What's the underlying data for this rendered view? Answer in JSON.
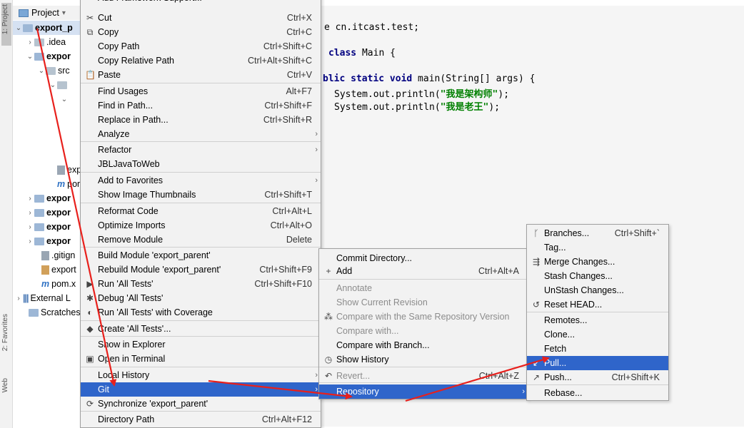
{
  "left_strip": {
    "project_tab": "1: Project",
    "favorites_tab": "2: Favorites",
    "web_tab": "Web"
  },
  "project_panel": {
    "header_label": "Project",
    "header_chevron": "▾",
    "tree": [
      {
        "arrow": "⌄",
        "icon": "folder",
        "label": "export_p",
        "bold": true
      },
      {
        "arrow": "›",
        "icon": "folder-gray",
        "label": ".idea",
        "bold": false
      },
      {
        "arrow": "⌄",
        "icon": "folder",
        "label": "expor",
        "bold": true
      },
      {
        "arrow": "⌄",
        "icon": "folder-gray",
        "label": "src",
        "bold": false
      },
      {
        "arrow": "⌄",
        "icon": "folder-gray",
        "label": "",
        "bold": false
      },
      {
        "arrow": "⌄",
        "icon": "",
        "label": "",
        "bold": false
      },
      {
        "arrow": "",
        "icon": "file-gen",
        "label": "exp",
        "bold": false
      },
      {
        "arrow": "",
        "icon": "file-m",
        "label": "pom",
        "bold": false
      },
      {
        "arrow": "›",
        "icon": "folder",
        "label": "expor",
        "bold": true
      },
      {
        "arrow": "›",
        "icon": "folder",
        "label": "expor",
        "bold": true
      },
      {
        "arrow": "›",
        "icon": "folder",
        "label": "expor",
        "bold": true
      },
      {
        "arrow": "›",
        "icon": "folder",
        "label": "expor",
        "bold": true
      },
      {
        "arrow": "",
        "icon": "file-gen",
        "label": ".gitign",
        "bold": false
      },
      {
        "arrow": "",
        "icon": "file-or",
        "label": "export",
        "bold": false
      },
      {
        "arrow": "",
        "icon": "file-m",
        "label": "pom.x",
        "bold": false
      },
      {
        "arrow": "›",
        "icon": "bars",
        "label": "External L",
        "bold": false
      },
      {
        "arrow": "",
        "icon": "scratch",
        "label": "Scratches",
        "bold": false
      }
    ]
  },
  "editor": {
    "lines": [
      {
        "a": "e cn.itcast.test;",
        "kind": "plain"
      },
      {
        "a": "class",
        "b": " Main {",
        "kind": "class"
      },
      {
        "a": "blic static void",
        "b": " main(String[] args) {",
        "kind": "method"
      },
      {
        "a": "System.out.println(",
        "b": "\"我是架构师\"",
        "c": ");",
        "kind": "print"
      },
      {
        "a": "System.out.println(",
        "b": "\"我是老王\"",
        "c": ");",
        "kind": "print"
      }
    ]
  },
  "context_menu": {
    "top_partial": "Add Framework Support...",
    "items": [
      {
        "icon": "✂",
        "icon_name": "cut-icon",
        "label": "Cut",
        "shortcut": "Ctrl+X"
      },
      {
        "icon": "⧉",
        "icon_name": "copy-icon",
        "label": "Copy",
        "shortcut": "Ctrl+C"
      },
      {
        "icon": "",
        "icon_name": "",
        "label": "Copy Path",
        "shortcut": "Ctrl+Shift+C"
      },
      {
        "icon": "",
        "icon_name": "",
        "label": "Copy Relative Path",
        "shortcut": "Ctrl+Alt+Shift+C"
      },
      {
        "icon": "📋",
        "icon_name": "paste-icon",
        "label": "Paste",
        "shortcut": "Ctrl+V"
      },
      {
        "icon": "",
        "icon_name": "",
        "label": "Find Usages",
        "shortcut": "Alt+F7"
      },
      {
        "icon": "",
        "icon_name": "",
        "label": "Find in Path...",
        "shortcut": "Ctrl+Shift+F"
      },
      {
        "icon": "",
        "icon_name": "",
        "label": "Replace in Path...",
        "shortcut": "Ctrl+Shift+R"
      },
      {
        "icon": "",
        "icon_name": "",
        "label": "Analyze",
        "shortcut": "",
        "submenu": true
      },
      {
        "icon": "",
        "icon_name": "",
        "label": "Refactor",
        "shortcut": "",
        "submenu": true
      },
      {
        "icon": "",
        "icon_name": "",
        "label": "JBLJavaToWeb",
        "shortcut": ""
      },
      {
        "icon": "",
        "icon_name": "",
        "label": "Add to Favorites",
        "shortcut": "",
        "submenu": true
      },
      {
        "icon": "",
        "icon_name": "",
        "label": "Show Image Thumbnails",
        "shortcut": "Ctrl+Shift+T"
      },
      {
        "icon": "",
        "icon_name": "",
        "label": "Reformat Code",
        "shortcut": "Ctrl+Alt+L"
      },
      {
        "icon": "",
        "icon_name": "",
        "label": "Optimize Imports",
        "shortcut": "Ctrl+Alt+O"
      },
      {
        "icon": "",
        "icon_name": "",
        "label": "Remove Module",
        "shortcut": "Delete"
      },
      {
        "icon": "",
        "icon_name": "",
        "label": "Build Module 'export_parent'",
        "shortcut": ""
      },
      {
        "icon": "",
        "icon_name": "",
        "label": "Rebuild Module 'export_parent'",
        "shortcut": "Ctrl+Shift+F9"
      },
      {
        "icon": "▶",
        "icon_name": "run-icon",
        "label": "Run 'All Tests'",
        "shortcut": "Ctrl+Shift+F10"
      },
      {
        "icon": "✱",
        "icon_name": "debug-icon",
        "label": "Debug 'All Tests'",
        "shortcut": ""
      },
      {
        "icon": "◐",
        "icon_name": "coverage-icon",
        "label": "Run 'All Tests' with Coverage",
        "shortcut": ""
      },
      {
        "icon": "◆",
        "icon_name": "create-test-icon",
        "label": "Create 'All Tests'...",
        "shortcut": ""
      },
      {
        "icon": "",
        "icon_name": "",
        "label": "Show in Explorer",
        "shortcut": ""
      },
      {
        "icon": "▣",
        "icon_name": "terminal-icon",
        "label": "Open in Terminal",
        "shortcut": ""
      },
      {
        "icon": "",
        "icon_name": "",
        "label": "Local History",
        "shortcut": "",
        "submenu": true
      },
      {
        "icon": "",
        "icon_name": "",
        "label": "Git",
        "shortcut": "",
        "submenu": true
      },
      {
        "icon": "⟳",
        "icon_name": "sync-icon",
        "label": "Synchronize 'export_parent'",
        "shortcut": ""
      },
      {
        "icon": "",
        "icon_name": "",
        "label": "Directory Path",
        "shortcut": "Ctrl+Alt+F12"
      }
    ]
  },
  "git_menu": {
    "items": [
      {
        "icon": "",
        "icon_name": "",
        "label": "Commit Directory...",
        "shortcut": "",
        "disabled": false
      },
      {
        "icon": "+",
        "icon_name": "add-icon",
        "label": "Add",
        "shortcut": "Ctrl+Alt+A",
        "disabled": false
      },
      {
        "icon": "",
        "icon_name": "",
        "label": "Annotate",
        "shortcut": "",
        "disabled": true
      },
      {
        "icon": "",
        "icon_name": "",
        "label": "Show Current Revision",
        "shortcut": "",
        "disabled": true
      },
      {
        "icon": "⁂",
        "icon_name": "compare-icon",
        "label": "Compare with the Same Repository Version",
        "shortcut": "",
        "disabled": true
      },
      {
        "icon": "",
        "icon_name": "",
        "label": "Compare with...",
        "shortcut": "",
        "disabled": true
      },
      {
        "icon": "",
        "icon_name": "",
        "label": "Compare with Branch...",
        "shortcut": "",
        "disabled": false
      },
      {
        "icon": "◷",
        "icon_name": "history-icon",
        "label": "Show History",
        "shortcut": "",
        "disabled": false
      },
      {
        "icon": "↶",
        "icon_name": "revert-icon",
        "label": "Revert...",
        "shortcut": "Ctrl+Alt+Z",
        "disabled": true
      },
      {
        "icon": "",
        "icon_name": "",
        "label": "Repository",
        "shortcut": "",
        "disabled": false,
        "submenu": true
      }
    ]
  },
  "repository_menu": {
    "items": [
      {
        "icon": "ᚴ",
        "icon_name": "branch-icon",
        "label": "Branches...",
        "shortcut": "Ctrl+Shift+`"
      },
      {
        "icon": "",
        "icon_name": "",
        "label": "Tag...",
        "shortcut": ""
      },
      {
        "icon": "⇶",
        "icon_name": "merge-icon",
        "label": "Merge Changes...",
        "shortcut": ""
      },
      {
        "icon": "",
        "icon_name": "",
        "label": "Stash Changes...",
        "shortcut": ""
      },
      {
        "icon": "",
        "icon_name": "",
        "label": "UnStash Changes...",
        "shortcut": ""
      },
      {
        "icon": "↺",
        "icon_name": "reset-icon",
        "label": "Reset HEAD...",
        "shortcut": ""
      },
      {
        "icon": "",
        "icon_name": "",
        "label": "Remotes...",
        "shortcut": ""
      },
      {
        "icon": "",
        "icon_name": "",
        "label": "Clone...",
        "shortcut": ""
      },
      {
        "icon": "",
        "icon_name": "",
        "label": "Fetch",
        "shortcut": ""
      },
      {
        "icon": "↙",
        "icon_name": "pull-icon",
        "label": "Pull...",
        "shortcut": ""
      },
      {
        "icon": "↗",
        "icon_name": "push-icon",
        "label": "Push...",
        "shortcut": "Ctrl+Shift+K"
      },
      {
        "icon": "",
        "icon_name": "",
        "label": "Rebase...",
        "shortcut": ""
      }
    ]
  },
  "colors": {
    "highlight": "#2f65ca",
    "annotation_arrow": "#e8201c",
    "keyword": "#000080",
    "string": "#008000"
  }
}
